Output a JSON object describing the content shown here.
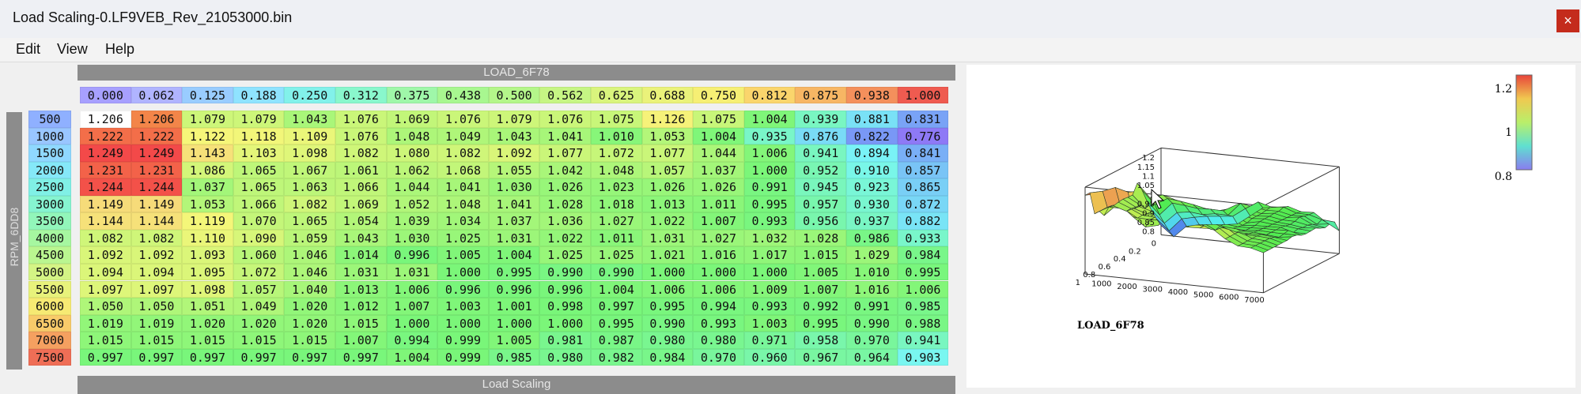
{
  "window": {
    "title": "Load Scaling-0.LF9VEB_Rev_21053000.bin",
    "close_glyph": "×"
  },
  "menu": [
    "Edit",
    "View",
    "Help"
  ],
  "table": {
    "column_axis_label": "LOAD_6F78",
    "row_axis_label": "RPM_6DD8",
    "footer_label": "Load Scaling",
    "columns": [
      "0.000",
      "0.062",
      "0.125",
      "0.188",
      "0.250",
      "0.312",
      "0.375",
      "0.438",
      "0.500",
      "0.562",
      "0.625",
      "0.688",
      "0.750",
      "0.812",
      "0.875",
      "0.938",
      "1.000"
    ],
    "rows": [
      {
        "rpm": "500",
        "values": [
          "1.206",
          "1.206",
          "1.079",
          "1.079",
          "1.043",
          "1.076",
          "1.069",
          "1.076",
          "1.079",
          "1.076",
          "1.075",
          "1.126",
          "1.075",
          "1.004",
          "0.939",
          "0.881",
          "0.831"
        ]
      },
      {
        "rpm": "1000",
        "values": [
          "1.222",
          "1.222",
          "1.122",
          "1.118",
          "1.109",
          "1.076",
          "1.048",
          "1.049",
          "1.043",
          "1.041",
          "1.010",
          "1.053",
          "1.004",
          "0.935",
          "0.876",
          "0.822",
          "0.776"
        ]
      },
      {
        "rpm": "1500",
        "values": [
          "1.249",
          "1.249",
          "1.143",
          "1.103",
          "1.098",
          "1.082",
          "1.080",
          "1.082",
          "1.092",
          "1.077",
          "1.072",
          "1.077",
          "1.044",
          "1.006",
          "0.941",
          "0.894",
          "0.841"
        ]
      },
      {
        "rpm": "2000",
        "values": [
          "1.231",
          "1.231",
          "1.086",
          "1.065",
          "1.067",
          "1.061",
          "1.062",
          "1.068",
          "1.055",
          "1.042",
          "1.048",
          "1.057",
          "1.037",
          "1.000",
          "0.952",
          "0.910",
          "0.857"
        ]
      },
      {
        "rpm": "2500",
        "values": [
          "1.244",
          "1.244",
          "1.037",
          "1.065",
          "1.063",
          "1.066",
          "1.044",
          "1.041",
          "1.030",
          "1.026",
          "1.023",
          "1.026",
          "1.026",
          "0.991",
          "0.945",
          "0.923",
          "0.865"
        ]
      },
      {
        "rpm": "3000",
        "values": [
          "1.149",
          "1.149",
          "1.053",
          "1.066",
          "1.082",
          "1.069",
          "1.052",
          "1.048",
          "1.041",
          "1.028",
          "1.018",
          "1.013",
          "1.011",
          "0.995",
          "0.957",
          "0.930",
          "0.872"
        ]
      },
      {
        "rpm": "3500",
        "values": [
          "1.144",
          "1.144",
          "1.119",
          "1.070",
          "1.065",
          "1.054",
          "1.039",
          "1.034",
          "1.037",
          "1.036",
          "1.027",
          "1.022",
          "1.007",
          "0.993",
          "0.956",
          "0.937",
          "0.882"
        ]
      },
      {
        "rpm": "4000",
        "values": [
          "1.082",
          "1.082",
          "1.110",
          "1.090",
          "1.059",
          "1.043",
          "1.030",
          "1.025",
          "1.031",
          "1.022",
          "1.011",
          "1.031",
          "1.027",
          "1.032",
          "1.028",
          "0.986",
          "0.933"
        ]
      },
      {
        "rpm": "4500",
        "values": [
          "1.092",
          "1.092",
          "1.093",
          "1.060",
          "1.046",
          "1.014",
          "0.996",
          "1.005",
          "1.004",
          "1.025",
          "1.025",
          "1.021",
          "1.016",
          "1.017",
          "1.015",
          "1.029",
          "0.984"
        ]
      },
      {
        "rpm": "5000",
        "values": [
          "1.094",
          "1.094",
          "1.095",
          "1.072",
          "1.046",
          "1.031",
          "1.031",
          "1.000",
          "0.995",
          "0.990",
          "0.990",
          "1.000",
          "1.000",
          "1.000",
          "1.005",
          "1.010",
          "0.995"
        ]
      },
      {
        "rpm": "5500",
        "values": [
          "1.097",
          "1.097",
          "1.098",
          "1.057",
          "1.040",
          "1.013",
          "1.006",
          "0.996",
          "0.996",
          "0.996",
          "1.004",
          "1.006",
          "1.006",
          "1.009",
          "1.007",
          "1.016",
          "1.006"
        ]
      },
      {
        "rpm": "6000",
        "values": [
          "1.050",
          "1.050",
          "1.051",
          "1.049",
          "1.020",
          "1.012",
          "1.007",
          "1.003",
          "1.001",
          "0.998",
          "0.997",
          "0.995",
          "0.994",
          "0.993",
          "0.992",
          "0.991",
          "0.985"
        ]
      },
      {
        "rpm": "6500",
        "values": [
          "1.019",
          "1.019",
          "1.020",
          "1.020",
          "1.020",
          "1.015",
          "1.000",
          "1.000",
          "1.000",
          "1.000",
          "0.995",
          "0.990",
          "0.993",
          "1.003",
          "0.995",
          "0.990",
          "0.988"
        ]
      },
      {
        "rpm": "7000",
        "values": [
          "1.015",
          "1.015",
          "1.015",
          "1.015",
          "1.015",
          "1.007",
          "0.994",
          "0.999",
          "1.005",
          "0.981",
          "0.987",
          "0.980",
          "0.980",
          "0.971",
          "0.958",
          "0.970",
          "0.941"
        ]
      },
      {
        "rpm": "7500",
        "values": [
          "0.997",
          "0.997",
          "0.997",
          "0.997",
          "0.997",
          "0.997",
          "1.004",
          "0.999",
          "0.985",
          "0.980",
          "0.982",
          "0.984",
          "0.970",
          "0.960",
          "0.967",
          "0.964",
          "0.903"
        ]
      }
    ]
  },
  "graph": {
    "x_axis_label": "LOAD_6F78",
    "y_ticks": [
      "1.2",
      "1.15",
      "1.1",
      "1.05",
      "1",
      "0.95",
      "0.9",
      "0.85",
      "0.8"
    ],
    "x_ticks": [
      "0",
      "0.2",
      "0.4",
      "0.6",
      "0.8",
      "1"
    ],
    "rpm_ticks": [
      "1000",
      "2000",
      "3000",
      "4000",
      "5000",
      "6000",
      "7000"
    ],
    "colorbar_labels": [
      "1.2",
      "1",
      "0.8"
    ]
  }
}
